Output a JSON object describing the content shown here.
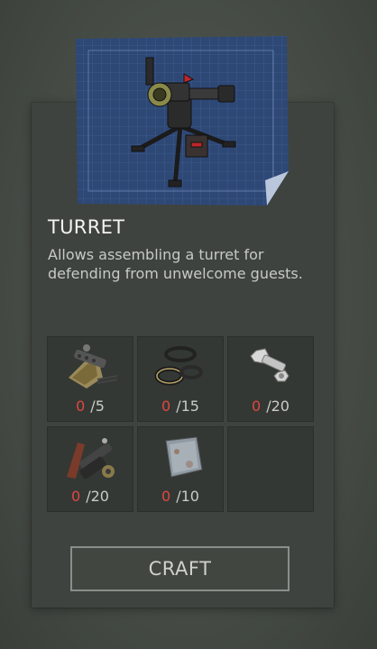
{
  "item": {
    "title": "TURRET",
    "description": "Allows assembling a turret for defending from unwelcome guests."
  },
  "ingredients": [
    {
      "icon": "weapon-parts-icon",
      "have": "0",
      "need": "/5"
    },
    {
      "icon": "rubber-rings-icon",
      "have": "0",
      "need": "/15"
    },
    {
      "icon": "bolt-nut-icon",
      "have": "0",
      "need": "/20"
    },
    {
      "icon": "mechanical-parts-icon",
      "have": "0",
      "need": "/20"
    },
    {
      "icon": "metal-plate-icon",
      "have": "0",
      "need": "/10"
    }
  ],
  "craft_label": "CRAFT",
  "colors": {
    "missing_count": "#e0473e",
    "blueprint": "#2f4a7a"
  }
}
